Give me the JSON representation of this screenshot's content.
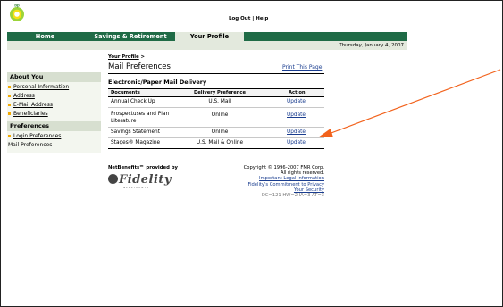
{
  "header": {
    "logo_text": "bp",
    "logout_label": "Log Out",
    "separator": "|",
    "help_label": "Help"
  },
  "nav": {
    "tabs": [
      {
        "label": "Home"
      },
      {
        "label": "Savings & Retirement"
      },
      {
        "label": "Your Profile"
      }
    ],
    "date": "Thursday, January 4, 2007"
  },
  "sidebar": {
    "about_heading": "About You",
    "about_items": [
      {
        "label": "Personal Information"
      },
      {
        "label": "Address"
      },
      {
        "label": "E-Mail Address"
      },
      {
        "label": "Beneficiaries"
      }
    ],
    "pref_heading": "Preferences",
    "pref_items": [
      {
        "label": "Login Preferences"
      },
      {
        "label": "Mail Preferences"
      }
    ]
  },
  "main": {
    "breadcrumb": "Your Profile",
    "breadcrumb_sep": ">",
    "title": "Mail Preferences",
    "print_label": "Print This Page",
    "section_title": "Electronic/Paper Mail Delivery",
    "columns": [
      "Documents",
      "Delivery Preference",
      "Action"
    ],
    "rows": [
      {
        "document": "Annual Check Up",
        "preference": "U.S. Mail",
        "action": "Update"
      },
      {
        "document": "Prospectuses and Plan Literature",
        "preference": "Online",
        "action": "Update"
      },
      {
        "document": "Savings Statement",
        "preference": "Online",
        "action": "Update"
      },
      {
        "document": "Stages® Magazine",
        "preference": "U.S. Mail & Online",
        "action": "Update"
      }
    ]
  },
  "footer": {
    "provided_by": "NetBenefits℠ provided by",
    "brand": "Fidelity",
    "brand_sub": "INVESTMENTS",
    "copyright": "Copyright © 1996-2007 FMR Corp.",
    "rights": "All rights reserved.",
    "legal_link": "Important Legal Information",
    "privacy_link": "Fidelity's Commitment to Privacy",
    "security_link": "Your Security",
    "code": "DC=121 HW=2 IA=3 AT=3"
  },
  "colors": {
    "nav_green": "#1f6b46",
    "tab_active": "#e3e9dd",
    "bullet": "#f2a800",
    "link_blue": "#1a3d8f",
    "arrow": "#f2621c"
  }
}
